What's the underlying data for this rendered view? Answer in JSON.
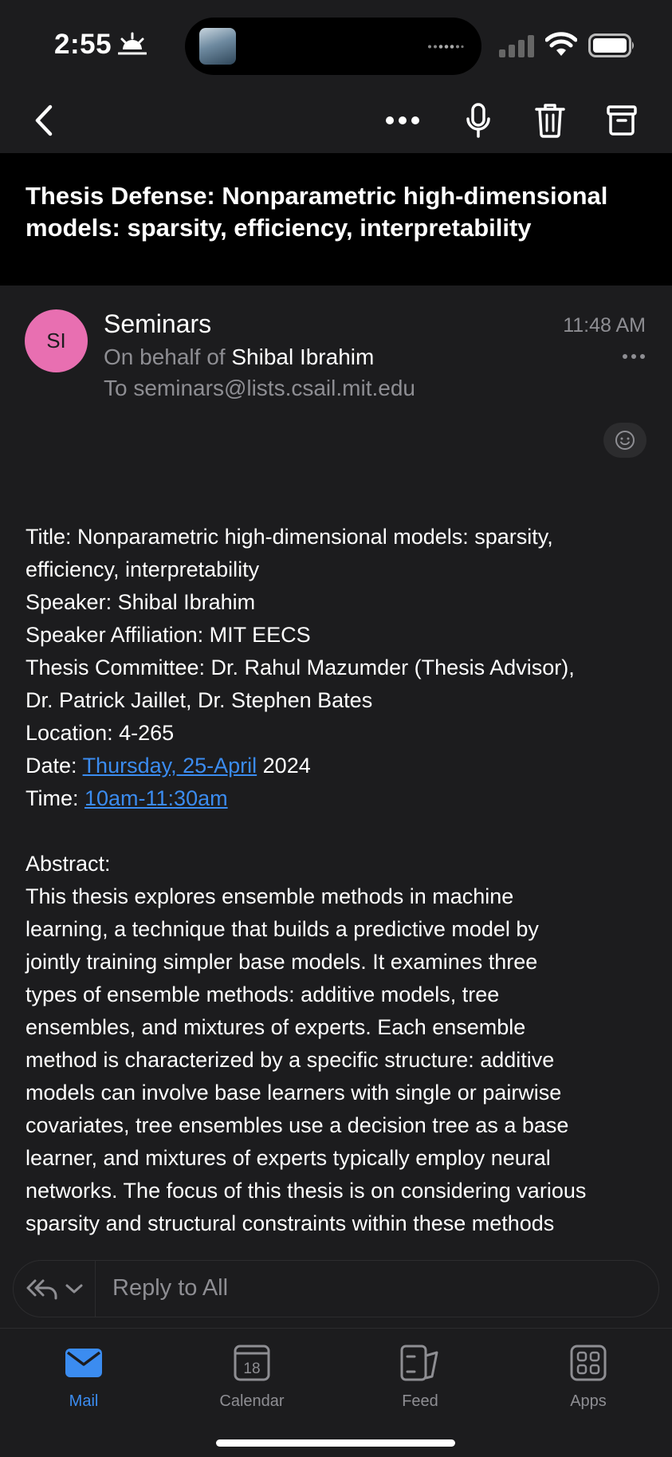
{
  "status_bar": {
    "time": "2:55"
  },
  "toolbar": {
    "back_icon": "chevron-left-icon",
    "more_icon": "more-horizontal-icon",
    "mic_icon": "microphone-icon",
    "delete_icon": "trash-icon",
    "archive_icon": "archive-icon"
  },
  "email": {
    "subject": "Thesis Defense: Nonparametric high-dimensional models: sparsity, efficiency, interpretability",
    "avatar_initials": "SI",
    "avatar_color": "#e86fb1",
    "sender": "Seminars",
    "time": "11:48 AM",
    "behalf_prefix": "On behalf of",
    "behalf_name": "Shibal Ibrahim",
    "to": "To seminars@lists.csail.mit.edu",
    "body": {
      "title_line1": "Title: Nonparametric high-dimensional models: sparsity,",
      "title_line2": "efficiency, interpretability",
      "speaker": "Speaker: Shibal Ibrahim",
      "affiliation": "Speaker Affiliation: MIT EECS",
      "committee_line1": "Thesis Committee: Dr. Rahul Mazumder (Thesis Advisor),",
      "committee_line2": "Dr. Patrick Jaillet, Dr. Stephen Bates",
      "location": "Location: 4-265",
      "date_label": "Date: ",
      "date_link": "Thursday, 25-April",
      "date_rest": " 2024",
      "time_label": "Time: ",
      "time_link": "10am-11:30am",
      "abstract_heading": "Abstract:",
      "abstract_lines": [
        "This thesis explores ensemble methods in machine",
        "learning, a technique that builds a predictive model by",
        "jointly training simpler base models. It examines three",
        "types of ensemble methods: additive models, tree",
        "ensembles, and mixtures of experts. Each ensemble",
        "method is characterized by a specific structure: additive",
        "models can involve base learners with single or pairwise",
        "covariates, tree ensembles use a decision tree as a base",
        "learner, and mixtures of experts typically employ neural",
        "networks. The focus of this thesis is on considering various",
        "sparsity and structural constraints within these methods"
      ]
    }
  },
  "reply": {
    "placeholder": "Reply to All"
  },
  "tabs": [
    {
      "label": "Mail",
      "icon": "mail-icon",
      "active": true
    },
    {
      "label": "Calendar",
      "icon": "calendar-icon",
      "day": "18",
      "active": false
    },
    {
      "label": "Feed",
      "icon": "feed-icon",
      "active": false
    },
    {
      "label": "Apps",
      "icon": "apps-grid-icon",
      "active": false
    }
  ],
  "colors": {
    "accent": "#3b8cf0",
    "background": "#1c1c1e"
  }
}
